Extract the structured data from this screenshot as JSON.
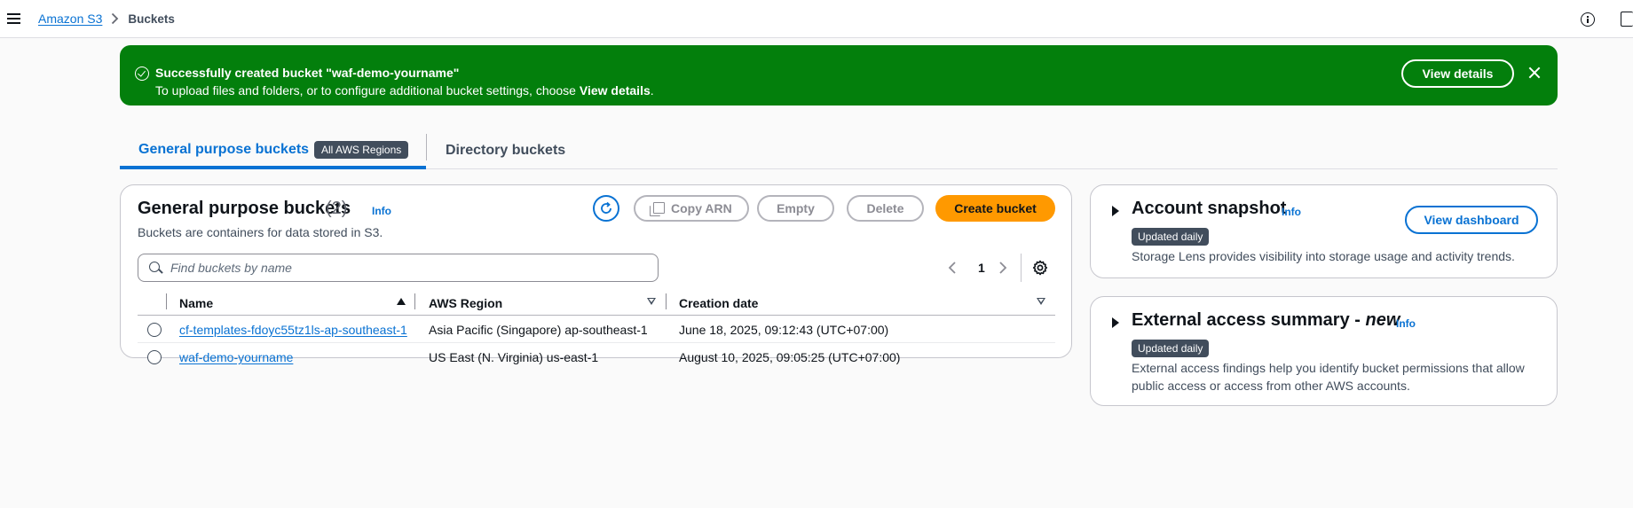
{
  "breadcrumb": {
    "root": "Amazon S3",
    "current": "Buckets"
  },
  "flash": {
    "title": "Successfully created bucket \"waf-demo-yourname\"",
    "message_prefix": "To upload files and folders, or to configure additional bucket settings, choose ",
    "message_bold": "View details",
    "message_suffix": ".",
    "button_label": "View details",
    "color": "#037f0c"
  },
  "tabs": [
    {
      "label": "General purpose buckets",
      "badge": "All AWS Regions",
      "active": true
    },
    {
      "label": "Directory buckets",
      "active": false
    }
  ],
  "buckets_panel": {
    "title": "General purpose buckets",
    "count": "(2)",
    "info": "Info",
    "description": "Buckets are containers for data stored in S3.",
    "actions": {
      "copy_arn": "Copy ARN",
      "empty": "Empty",
      "delete": "Delete",
      "create": "Create bucket"
    },
    "search_placeholder": "Find buckets by name",
    "page": "1",
    "columns": [
      "Name",
      "AWS Region",
      "Creation date"
    ],
    "rows": [
      {
        "name": "cf-templates-fdoyc55tz1ls-ap-southeast-1",
        "region": "Asia Pacific (Singapore) ap-southeast-1",
        "created": "June 18, 2025, 09:12:43 (UTC+07:00)"
      },
      {
        "name": "waf-demo-yourname",
        "region": "US East (N. Virginia) us-east-1",
        "created": "August 10, 2025, 09:05:25 (UTC+07:00)"
      }
    ]
  },
  "snapshot": {
    "title": "Account snapshot",
    "info": "Info",
    "badge": "Updated daily",
    "description": "Storage Lens provides visibility into storage usage and activity trends.",
    "button": "View dashboard"
  },
  "external": {
    "title": "External access summary - ",
    "title_new": "new",
    "info": "Info",
    "badge": "Updated daily",
    "description_line1": "External access findings help you identify bucket permissions that allow",
    "description_line2": "public access or access from other AWS accounts."
  },
  "colors": {
    "accent": "#0972d3",
    "primary_button": "#ff9900",
    "success": "#037f0c"
  }
}
